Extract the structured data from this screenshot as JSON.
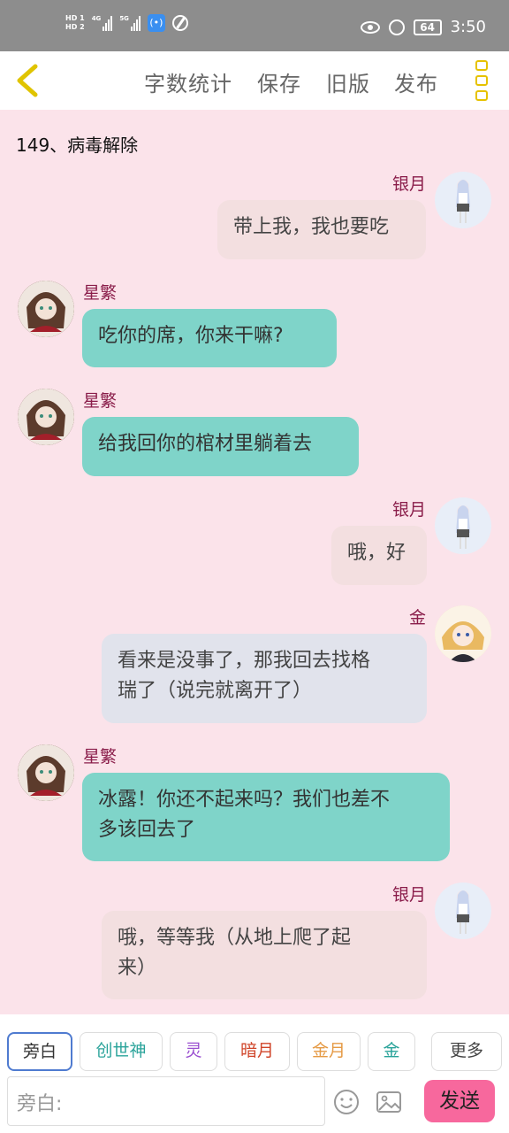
{
  "status_bar": {
    "hd1": "HD 1",
    "hd2": "HD 2",
    "signal1": "4G",
    "signal2": "5G",
    "battery": "64",
    "time": "3:50"
  },
  "header": {
    "back_icon": "chevron-left-icon",
    "buttons": [
      "字数统计",
      "保存",
      "旧版",
      "发布"
    ],
    "menu_icon": "more-icon"
  },
  "chapter_title": "149、病毒解除",
  "messages": [
    {
      "side": "right",
      "name": "银月",
      "text_lines": [
        "带上我，我也要吃"
      ],
      "color": "#f3dfe0",
      "avatar": "silver-moon-avatar"
    },
    {
      "side": "left",
      "name": "星繁",
      "text_lines": [
        "吃你的席，你来干嘛?"
      ],
      "color": "#7fd4c9",
      "avatar": "xingfan-avatar"
    },
    {
      "side": "left",
      "name": "星繁",
      "text_lines": [
        "给我回你的棺材里躺着去"
      ],
      "color": "#7fd4c9",
      "avatar": "xingfan-avatar"
    },
    {
      "side": "right",
      "name": "银月",
      "text_lines": [
        "哦，好"
      ],
      "color": "#f3dfe0",
      "avatar": "silver-moon-avatar"
    },
    {
      "side": "right",
      "name": "金",
      "text_lines": [
        "看来是没事了，那我回去找格",
        "瑞了（说完就离开了）"
      ],
      "color": "#e1e3ec",
      "avatar": "jin-avatar"
    },
    {
      "side": "left",
      "name": "星繁",
      "text_lines": [
        "冰露！你还不起来吗？我们也差不",
        "多该回去了"
      ],
      "color": "#7fd4c9",
      "avatar": "xingfan-avatar"
    },
    {
      "side": "right",
      "name": "银月",
      "text_lines": [
        "哦，等等我（从地上爬了起",
        "来）"
      ],
      "color": "#f3dfe0",
      "avatar": "silver-moon-avatar"
    }
  ],
  "role_chips": [
    {
      "label": "旁白",
      "color": "#444444",
      "active": true
    },
    {
      "label": "创世神",
      "color": "#2aa39a"
    },
    {
      "label": "灵",
      "color": "#9a4fd0"
    },
    {
      "label": "暗月",
      "color": "#d0452a"
    },
    {
      "label": "金月",
      "color": "#e59a45"
    },
    {
      "label": "金",
      "color": "#2aa39a"
    }
  ],
  "more_label": "更多",
  "input": {
    "placeholder": "旁白:"
  },
  "emoji_icon": "emoji-icon",
  "image_icon": "image-icon",
  "send_label": "发送"
}
